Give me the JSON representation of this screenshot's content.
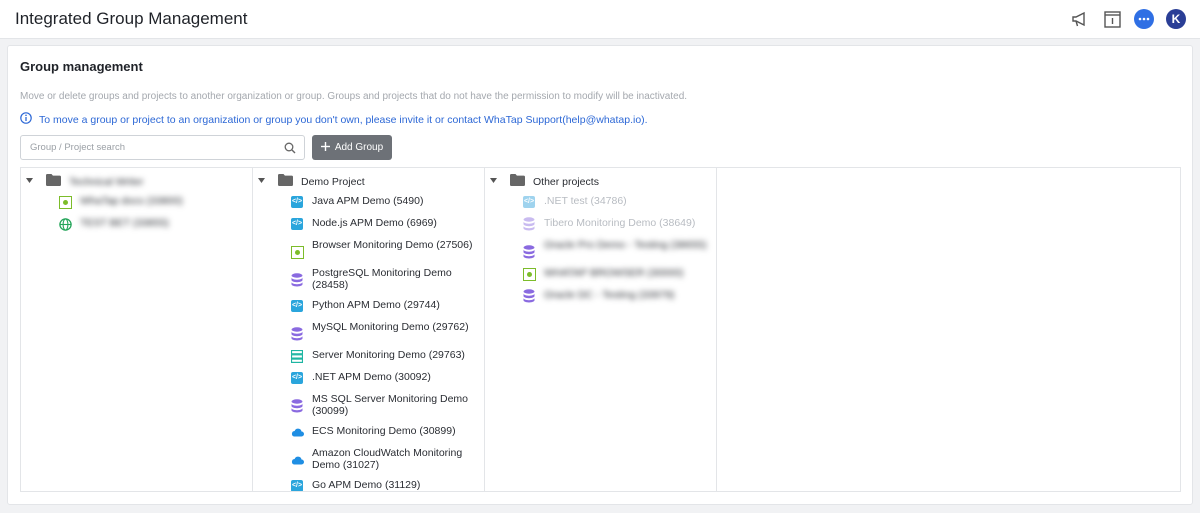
{
  "app": {
    "title": "Integrated Group Management",
    "avatar_letter": "K"
  },
  "top_icons": [
    "megaphone-icon",
    "info-panel-icon",
    "chat-icon",
    "avatar"
  ],
  "panel": {
    "title": "Group management",
    "description": "Move or delete groups and projects to another organization or group. Groups and projects that do not have the permission to modify will be inactivated.",
    "info": "To move a group or project to an organization or group you don't own, please invite it or contact WhaTap Support(help@whatap.io).",
    "search_placeholder": "Group / Project search",
    "add_group_label": "Add Group"
  },
  "columns": [
    {
      "group": "Technical Writer",
      "blurred_group": true,
      "items": [
        {
          "label": "WhaTap docs (33800)",
          "icon": "browser-icon",
          "blurred": true
        },
        {
          "label": "TEST BET (33855)",
          "icon": "globe-icon",
          "blurred": true
        }
      ]
    },
    {
      "group": "Demo Project",
      "items": [
        {
          "label": "Java APM Demo (5490)",
          "icon": "code-icon"
        },
        {
          "label": "Node.js APM Demo (6969)",
          "icon": "code-icon"
        },
        {
          "label": "Browser Monitoring Demo (27506)",
          "icon": "browser-icon",
          "two": true
        },
        {
          "label": "PostgreSQL Monitoring Demo (28458)",
          "icon": "database-icon",
          "two": true
        },
        {
          "label": "Python APM Demo (29744)",
          "icon": "code-icon"
        },
        {
          "label": "MySQL Monitoring Demo (29762)",
          "icon": "database-icon",
          "two": true
        },
        {
          "label": "Server Monitoring Demo (29763)",
          "icon": "server-icon"
        },
        {
          "label": ".NET APM Demo (30092)",
          "icon": "code-icon"
        },
        {
          "label": "MS SQL Server Monitoring Demo (30099)",
          "icon": "database-icon",
          "two": true
        },
        {
          "label": "ECS Monitoring Demo (30899)",
          "icon": "cloud-icon"
        },
        {
          "label": "Amazon CloudWatch Monitoring Demo (31027)",
          "icon": "cloud-icon",
          "two": true
        },
        {
          "label": "Go APM Demo (31129)",
          "icon": "code-icon"
        }
      ]
    },
    {
      "group": "Other projects",
      "items": [
        {
          "label": ".NET test (34786)",
          "icon": "code-icon",
          "disabled": true
        },
        {
          "label": "Tibero Monitoring Demo (38649)",
          "icon": "database-icon",
          "disabled": true
        },
        {
          "label": "Oracle Pro Demo - Testing (38655)",
          "icon": "database-icon",
          "blurred": true,
          "two": true
        },
        {
          "label": "WHATAP BROWSER (30000)",
          "icon": "browser-icon",
          "blurred": true
        },
        {
          "label": "Oracle DC - Testing (33979)",
          "icon": "database-icon",
          "blurred": true
        }
      ]
    }
  ],
  "colors": {
    "accent": "#2d68d6",
    "code": "#2aa5dc",
    "database": "#8a6ae0",
    "server": "#1eb5a2",
    "cloud": "#1f8ee3",
    "browser": "#7cbc2a",
    "globe": "#25a55a"
  }
}
